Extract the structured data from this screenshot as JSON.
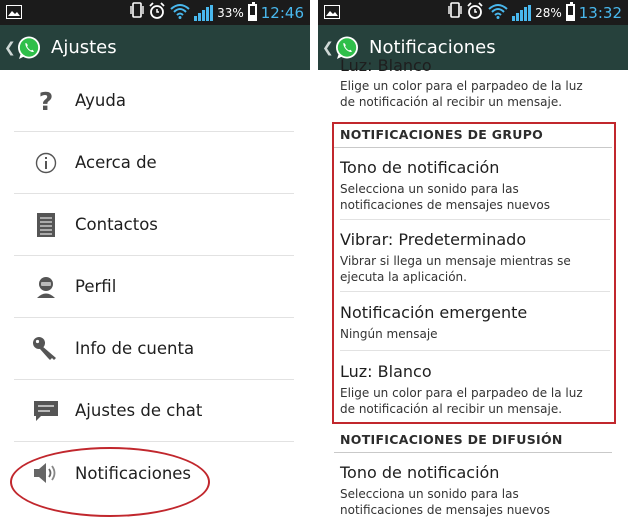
{
  "left_screen": {
    "status": {
      "battery": "33%",
      "time": "12:46"
    },
    "title": "Ajustes",
    "items": [
      {
        "label": "Ayuda",
        "icon": "help-icon"
      },
      {
        "label": "Acerca de",
        "icon": "info-icon"
      },
      {
        "label": "Contactos",
        "icon": "contacts-icon"
      },
      {
        "label": "Perfil",
        "icon": "profile-icon"
      },
      {
        "label": "Info de cuenta",
        "icon": "key-icon"
      },
      {
        "label": "Ajustes de chat",
        "icon": "chat-icon"
      },
      {
        "label": "Notificaciones",
        "icon": "speaker-icon"
      }
    ]
  },
  "right_screen": {
    "status": {
      "battery": "28%",
      "time": "13:32"
    },
    "title": "Notificaciones",
    "partial_top": {
      "title": "Luz: Blanco",
      "summary_1": "Elige un color para el parpadeo de la luz",
      "summary_2": "de notificación al recibir un mensaje."
    },
    "group_header": "NOTIFICACIONES DE GRUPO",
    "group_prefs": [
      {
        "title": "Tono de notificación",
        "summary_1": "Selecciona un sonido para las",
        "summary_2": "notificaciones de mensajes nuevos"
      },
      {
        "title": "Vibrar: Predeterminado",
        "summary_1": "Vibrar si llega un mensaje mientras se",
        "summary_2": "ejecuta la aplicación."
      },
      {
        "title": "Notificación emergente",
        "summary_1": "Ningún mensaje",
        "summary_2": ""
      },
      {
        "title": "Luz: Blanco",
        "summary_1": "Elige un color para el parpadeo de la luz",
        "summary_2": "de notificación al recibir un mensaje."
      }
    ],
    "broadcast_header": "NOTIFICACIONES DE DIFUSIÓN",
    "broadcast_prefs": [
      {
        "title": "Tono de notificación",
        "summary_1": "Selecciona un sonido para las",
        "summary_2": "notificaciones de mensajes nuevos"
      }
    ]
  },
  "colors": {
    "action_bar": "#26413c",
    "status_bar": "#1b1b1b",
    "accent_blue": "#49b8ee",
    "highlight_red": "#c1272d",
    "whatsapp_green": "#2fbf4a"
  }
}
